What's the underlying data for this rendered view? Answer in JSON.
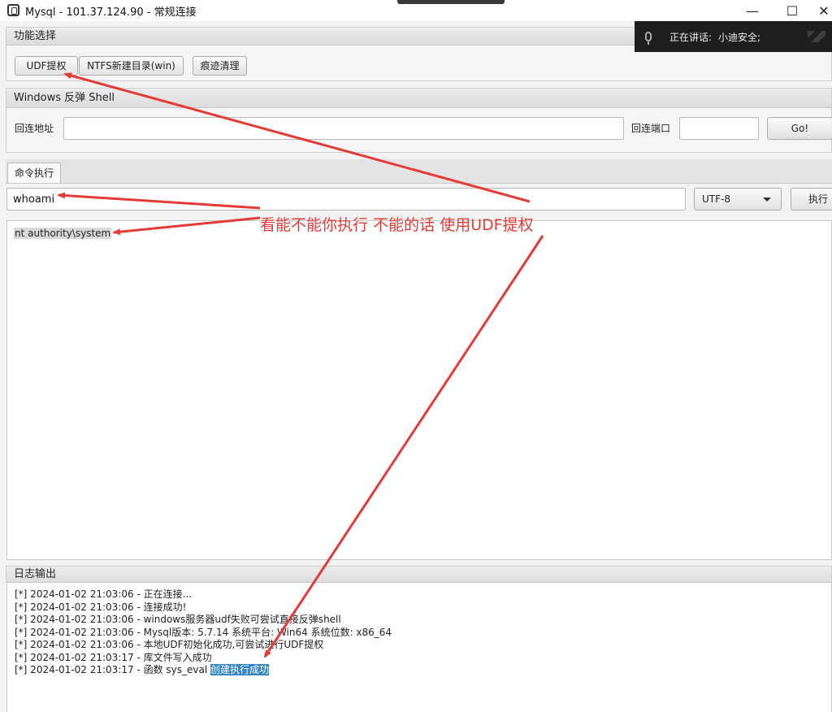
{
  "window": {
    "title": "Mysql - 101.37.124.90 - 常规连接",
    "minimize_glyph": "—",
    "maximize_glyph": "☐",
    "close_glyph": "✕"
  },
  "overlay": {
    "label": "正在讲话:",
    "speaker": "小迪安全;"
  },
  "function_panel": {
    "header": "功能选择",
    "buttons": [
      "UDF提权",
      "NTFS新建目录(win)",
      "痕迹清理"
    ]
  },
  "shell_panel": {
    "header": "Windows 反弹 Shell",
    "address_label": "回连地址",
    "address_value": "",
    "port_label": "回连端口",
    "port_value": "",
    "go_button": "Go!"
  },
  "command_panel": {
    "tab": "命令执行",
    "command_value": "whoami",
    "encoding": "UTF-8",
    "execute_button": "执行",
    "output": "nt authority\\system"
  },
  "log_panel": {
    "header": "日志输出",
    "lines": [
      "[*] 2024-01-02 21:03:06 - 正在连接...",
      "[*] 2024-01-02 21:03:06 - 连接成功!",
      "[*] 2024-01-02 21:03:06 - windows服务器udf失败可尝试直接反弹shell",
      "[*] 2024-01-02 21:03:06 - Mysql版本: 5.7.14 系统平台: Win64 系统位数: x86_64",
      "[*] 2024-01-02 21:03:06 - 本地UDF初始化成功,可尝试进行UDF提权",
      "[*] 2024-01-02 21:03:17 - 库文件写入成功"
    ],
    "last_line_prefix": "[*] 2024-01-02 21:03:17 - 函数 sys_eval ",
    "last_line_highlight": "创建执行成功"
  },
  "annotation": {
    "text": "看能不能你执行  不能的话 使用UDF提权",
    "color": "#e53b36"
  },
  "colors": {
    "accent_highlight": "#3584c4",
    "annotation_red": "#e53b36"
  }
}
